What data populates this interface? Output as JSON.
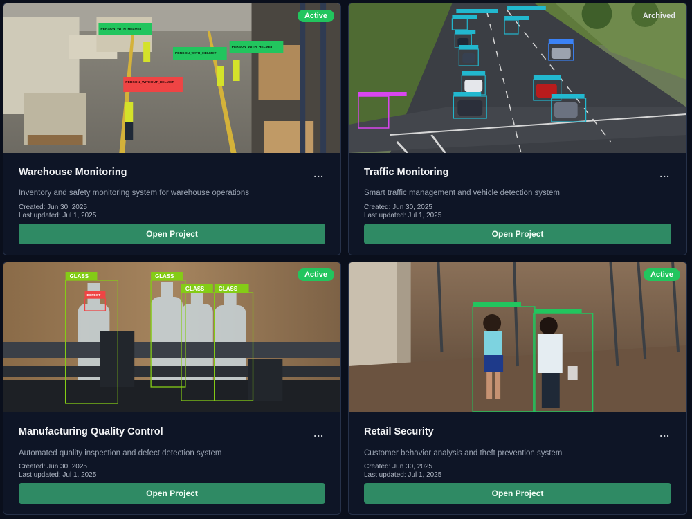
{
  "projects": [
    {
      "title": "Warehouse Monitoring",
      "status": "Active",
      "description": "Inventory and safety monitoring system for warehouse operations",
      "created": "Created: Jun 30, 2025",
      "updated": "Last updated: Jul 1, 2025",
      "button": "Open Project",
      "detections": [
        "PERSON_WITH_HELMET",
        "PERSON_WITH_HELMET",
        "PERSON_WITH_HELMET",
        "PERSON_WITHOUT_HELMET"
      ]
    },
    {
      "title": "Traffic Monitoring",
      "status": "Archived",
      "description": "Smart traffic management and vehicle detection system",
      "created": "Created: Jun 30, 2025",
      "updated": "Last updated: Jul 1, 2025",
      "button": "Open Project",
      "detections": []
    },
    {
      "title": "Manufacturing Quality Control",
      "status": "Active",
      "description": "Automated quality inspection and defect detection system",
      "created": "Created: Jun 30, 2025",
      "updated": "Last updated: Jul 1, 2025",
      "button": "Open Project",
      "detections": [
        "GLASS",
        "GLASS",
        "GLASS",
        "GLASS",
        "DEFECT"
      ]
    },
    {
      "title": "Retail Security",
      "status": "Active",
      "description": "Customer behavior analysis and theft prevention system",
      "created": "Created: Jun 30, 2025",
      "updated": "Last updated: Jul 1, 2025",
      "button": "Open Project",
      "detections": []
    }
  ],
  "more_menu": "...",
  "colors": {
    "active_badge": "#22c55e",
    "button": "#2f8a64",
    "card": "#0e1526",
    "detect_ok": "#22c55e",
    "detect_bad": "#ef4444"
  }
}
